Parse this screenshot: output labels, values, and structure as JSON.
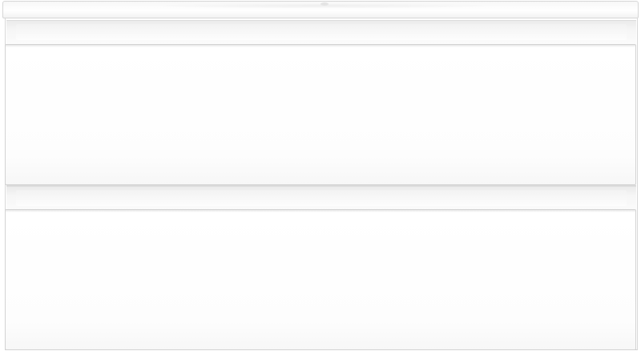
{
  "image": {
    "subject": "",
    "background_color": "#ffffff",
    "surface_color": "#ffffff",
    "edge_color": "#d3d3d3",
    "drawer_count": 2
  }
}
